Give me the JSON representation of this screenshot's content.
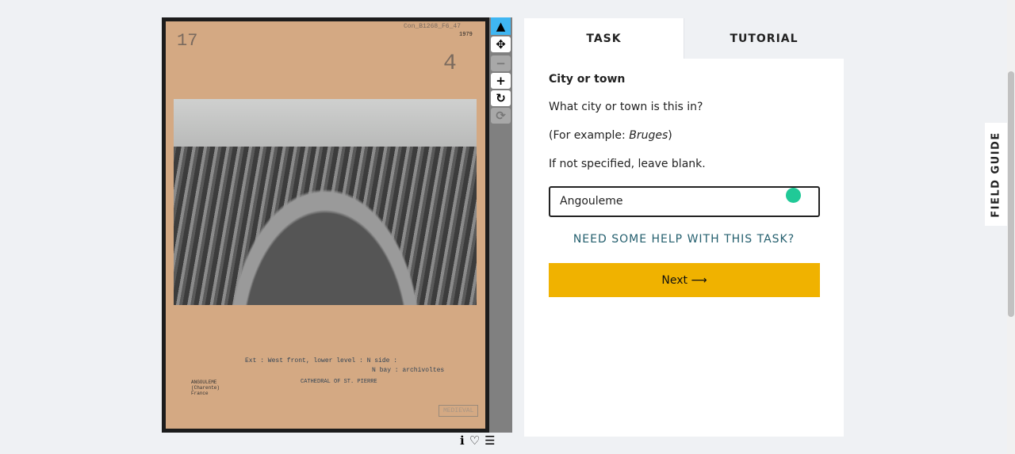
{
  "subject": {
    "catalog_number": "Con_B1268_F6_47",
    "year": "1979",
    "corner_mark": "17",
    "plate_mark": "4",
    "caption_line1": "Ext : West front, lower level : N side :",
    "caption_line2": "N bay : archivoltes",
    "caption_line3": "CATHEDRAL OF ST. PIERRE",
    "location_label": "ANGOULEME (Charente) France",
    "stamp": "MEDIEVAL"
  },
  "toolbar": {
    "select": "▲",
    "move": "✥",
    "zoom_out": "−",
    "zoom_in": "+",
    "rotate": "↻",
    "reset": "⟳"
  },
  "below": {
    "info": "ℹ",
    "favorite": "♡",
    "collections": "☰"
  },
  "tabs": {
    "task": "TASK",
    "tutorial": "TUTORIAL"
  },
  "task": {
    "title": "City or town",
    "question": "What city or town is this in?",
    "example_prefix": "(For example: ",
    "example": "Bruges",
    "example_suffix": ")",
    "note": "If not specified, leave blank.",
    "answer": "Angouleme",
    "help": "NEED SOME HELP WITH THIS TASK?",
    "next": "Next ⟶"
  },
  "field_guide": "FIELD GUIDE"
}
